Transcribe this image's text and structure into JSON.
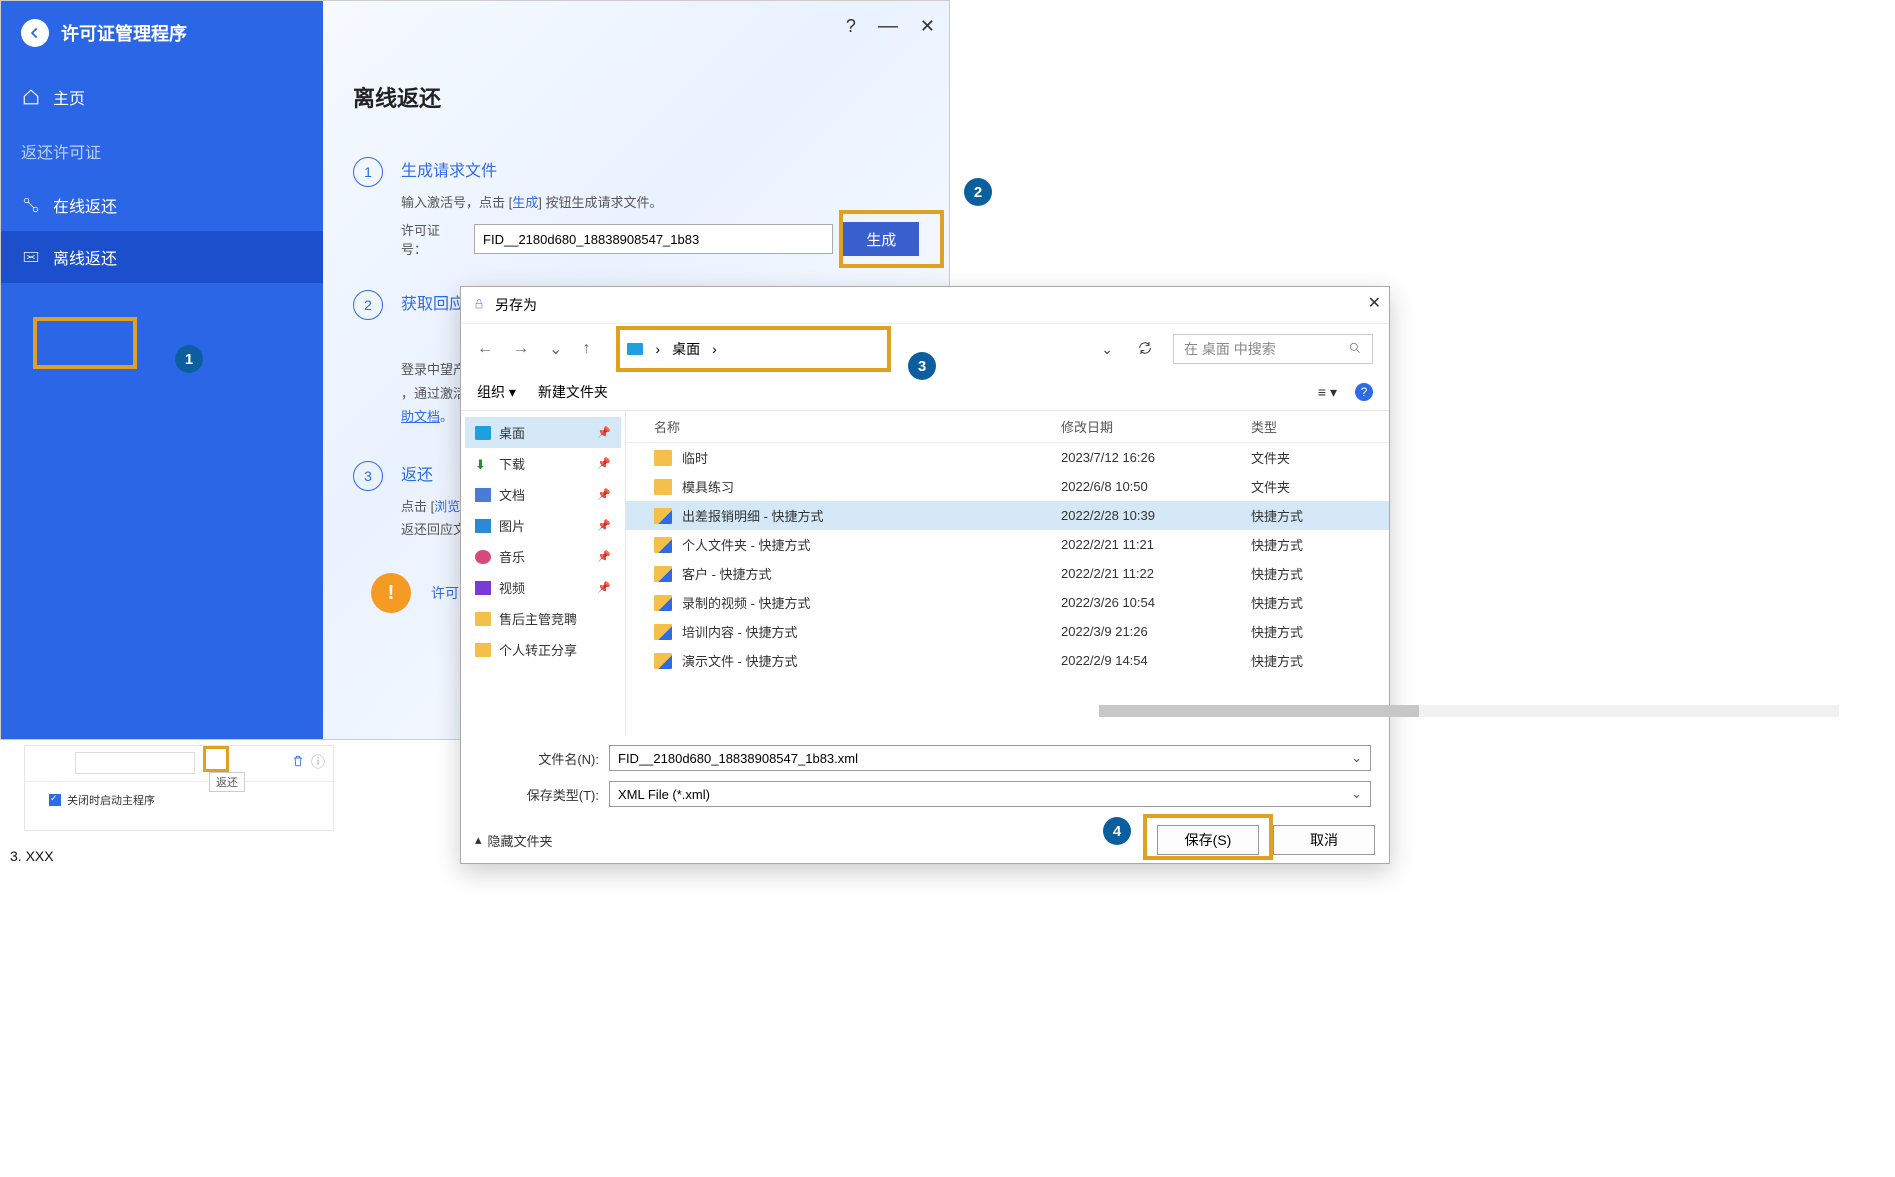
{
  "sidebar": {
    "app_title": "许可证管理程序",
    "home": "主页",
    "section_label": "返还许可证",
    "online_return": "在线返还",
    "offline_return": "离线返还"
  },
  "content": {
    "title": "离线返还",
    "step1": {
      "title": "生成请求文件",
      "text_prefix": "输入激活号，点击 [",
      "text_link": "生成",
      "text_suffix": "] 按钮生成请求文件。",
      "license_label": "许可证号：",
      "license_value": "FID__2180d680_18838908547_1b83",
      "generate_btn": "生成"
    },
    "step2": {
      "title": "获取回应",
      "text_a": "登录中望产",
      "text_b": "，通过激活",
      "text_link": "助文档",
      "text_c": "。"
    },
    "step3": {
      "title": "返还",
      "text_prefix": "点击 [",
      "text_link": "浏览",
      "text_suffix": "]",
      "text2": "返还回应文"
    },
    "info_label": "许可"
  },
  "annotations": {
    "1": "1",
    "2": "2",
    "3": "3",
    "4": "4"
  },
  "mini": {
    "tooltip": "返还",
    "checkbox_label": "关闭时启动主程序"
  },
  "outline_item": "3. XXX",
  "saveas": {
    "title": "另存为",
    "crumb_label": "桌面",
    "crumb_sep": "›",
    "search_placeholder": "在 桌面 中搜索",
    "toolbar_org": "组织",
    "toolbar_newfolder": "新建文件夹",
    "tree": {
      "desktop": "桌面",
      "downloads": "下载",
      "documents": "文档",
      "pictures": "图片",
      "music": "音乐",
      "videos": "视频",
      "f1": "售后主管竞聘",
      "f2": "个人转正分享"
    },
    "list_headers": {
      "name": "名称",
      "date": "修改日期",
      "type": "类型"
    },
    "rows": [
      {
        "name": "临时",
        "date": "2023/7/12 16:26",
        "type": "文件夹",
        "ico": "folder"
      },
      {
        "name": "模具练习",
        "date": "2022/6/8 10:50",
        "type": "文件夹",
        "ico": "folder"
      },
      {
        "name": "出差报销明细 - 快捷方式",
        "date": "2022/2/28 10:39",
        "type": "快捷方式",
        "ico": "shortcut",
        "sel": true
      },
      {
        "name": "个人文件夹 - 快捷方式",
        "date": "2022/2/21 11:21",
        "type": "快捷方式",
        "ico": "shortcut"
      },
      {
        "name": "客户 - 快捷方式",
        "date": "2022/2/21 11:22",
        "type": "快捷方式",
        "ico": "shortcut"
      },
      {
        "name": "录制的视频 - 快捷方式",
        "date": "2022/3/26 10:54",
        "type": "快捷方式",
        "ico": "shortcut"
      },
      {
        "name": "培训内容 - 快捷方式",
        "date": "2022/3/9 21:26",
        "type": "快捷方式",
        "ico": "shortcut"
      },
      {
        "name": "演示文件 - 快捷方式",
        "date": "2022/2/9 14:54",
        "type": "快捷方式",
        "ico": "shortcut"
      }
    ],
    "filename_label": "文件名(N):",
    "filename_value": "FID__2180d680_18838908547_1b83.xml",
    "filetype_label": "保存类型(T):",
    "filetype_value": "XML File (*.xml)",
    "hide_folders": "隐藏文件夹",
    "save_btn": "保存(S)",
    "cancel_btn": "取消"
  }
}
